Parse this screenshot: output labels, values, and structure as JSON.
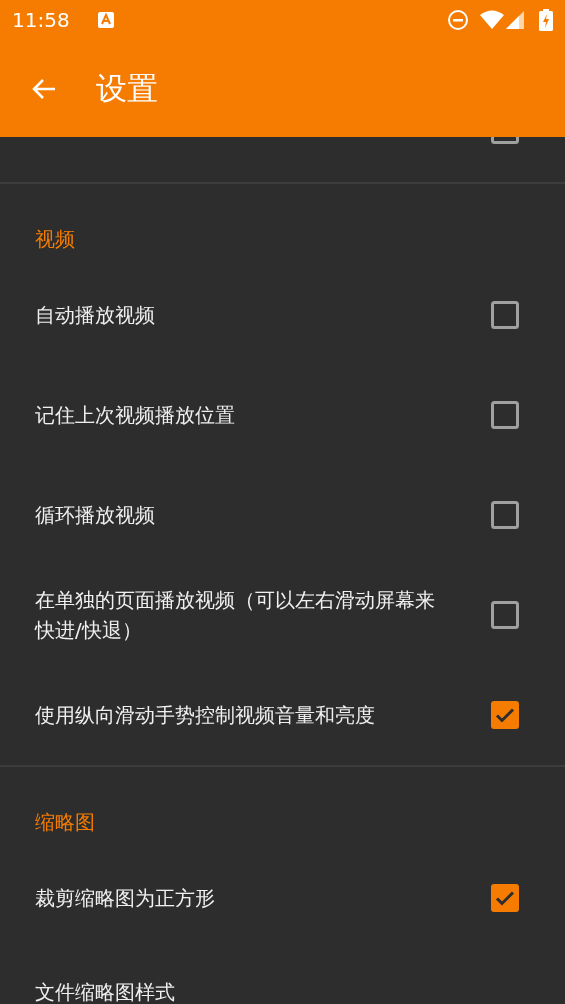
{
  "status_bar": {
    "time": "11:58"
  },
  "app_bar": {
    "title": "设置"
  },
  "partial_row": {
    "checked": false
  },
  "sections": [
    {
      "title": "视频",
      "items": [
        {
          "kind": "checkbox",
          "label": "自动播放视频",
          "checked": false
        },
        {
          "kind": "checkbox",
          "label": "记住上次视频播放位置",
          "checked": false
        },
        {
          "kind": "checkbox",
          "label": "循环播放视频",
          "checked": false
        },
        {
          "kind": "checkbox",
          "label": "在单独的页面播放视频（可以左右滑动屏幕来快进/快退）",
          "checked": false
        },
        {
          "kind": "checkbox",
          "label": "使用纵向滑动手势控制视频音量和亮度",
          "checked": true
        }
      ]
    },
    {
      "title": "缩略图",
      "items": [
        {
          "kind": "checkbox",
          "label": "裁剪缩略图为正方形",
          "checked": true
        },
        {
          "kind": "text",
          "label": "文件缩略图样式"
        }
      ]
    }
  ]
}
